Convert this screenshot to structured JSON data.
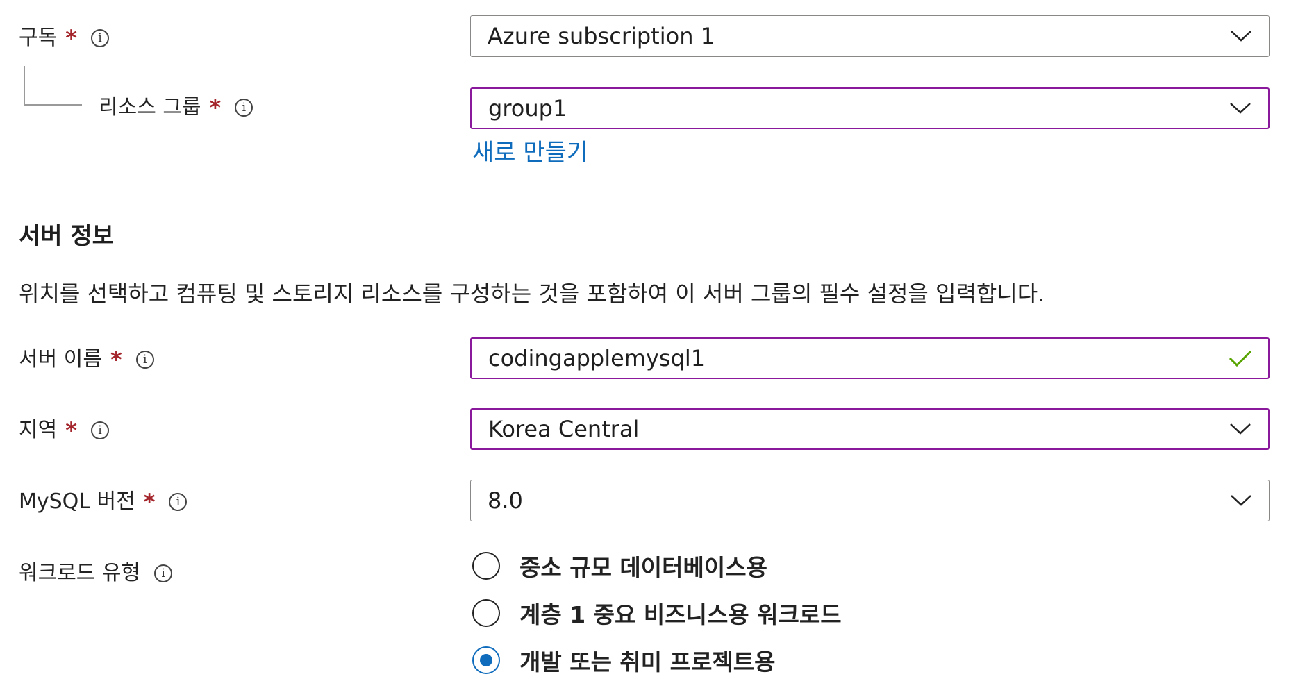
{
  "subscription": {
    "label": "구독",
    "required": "*",
    "info_glyph": "i",
    "value": "Azure subscription 1"
  },
  "resource_group": {
    "label": "리소스 그룹",
    "required": "*",
    "info_glyph": "i",
    "value": "group1",
    "create_new_link": "새로 만들기"
  },
  "server_details": {
    "title": "서버 정보",
    "description": "위치를 선택하고 컴퓨팅 및 스토리지 리소스를 구성하는 것을 포함하여 이 서버 그룹의 필수 설정을 입력합니다."
  },
  "server_name": {
    "label": "서버 이름",
    "required": "*",
    "info_glyph": "i",
    "value": "codingapplemysql1",
    "validation_icon": "checkmark-icon"
  },
  "region": {
    "label": "지역",
    "required": "*",
    "info_glyph": "i",
    "value": "Korea Central"
  },
  "mysql_version": {
    "label": "MySQL 버전",
    "required": "*",
    "info_glyph": "i",
    "value": "8.0"
  },
  "workload_type": {
    "label": "워크로드 유형",
    "info_glyph": "i",
    "options": [
      {
        "label": "중소 규모 데이터베이스용",
        "checked": false
      },
      {
        "label": "계층 1 중요 비즈니스용 워크로드",
        "checked": false
      },
      {
        "label": "개발 또는 취미 프로젝트용",
        "checked": true
      }
    ]
  },
  "colors": {
    "focus_border": "#8a1a9b",
    "required_star": "#a4262c",
    "link": "#0f6cbd",
    "radio_checked": "#0f6cbd",
    "valid_check": "#57a300"
  }
}
